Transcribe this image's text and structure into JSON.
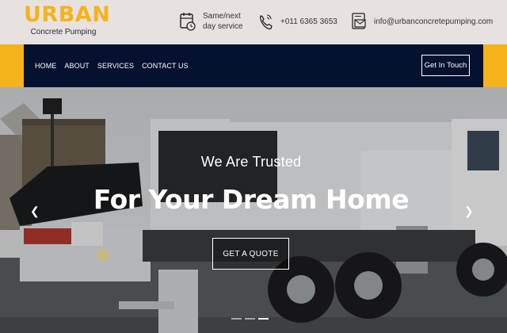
{
  "brand": {
    "name": "URBAN",
    "tagline": "Concrete Pumping",
    "accent": "#f5b21b",
    "navy": "#04112f"
  },
  "contact": {
    "service_line1": "Same/next",
    "service_line2": "day service",
    "service_icon": "calendar-clock-icon",
    "phone": "+011 6365 3653",
    "phone_icon": "phone-icon",
    "email": "info@urbanconcretepumping.com",
    "email_icon": "email-icon"
  },
  "nav": {
    "items": [
      {
        "label": "HOME"
      },
      {
        "label": "ABOUT"
      },
      {
        "label": "SERVICES"
      },
      {
        "label": "CONTACT US"
      }
    ],
    "cta_label": "Get In Touch"
  },
  "hero": {
    "kicker": "We Are Trusted",
    "title": "For Your Dream Home",
    "cta_label": "GET A QUOTE",
    "prev_icon": "chevron-left-icon",
    "next_icon": "chevron-right-icon",
    "slides": 3,
    "active_slide": 3,
    "image": "concrete-pump-truck-photo"
  }
}
